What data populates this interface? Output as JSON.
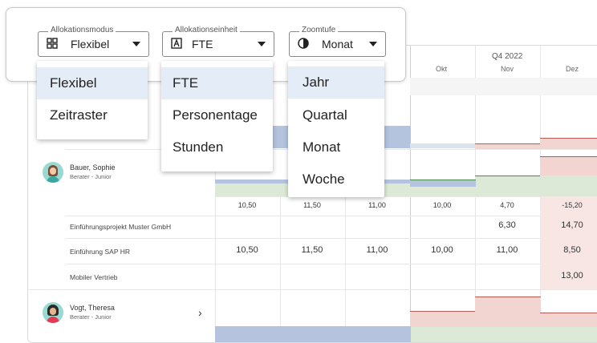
{
  "toolbar": {
    "allocation_mode": {
      "label": "Allokationsmodus",
      "value": "Flexibel",
      "icon": "grid-icon",
      "options": [
        "Flexibel",
        "Zeitraster"
      ]
    },
    "allocation_unit": {
      "label": "Allokationseinheit",
      "value": "FTE",
      "icon": "letter-a-icon",
      "options": [
        "FTE",
        "Personentage",
        "Stunden"
      ]
    },
    "zoom": {
      "label": "Zoomtufe",
      "value": "Monat",
      "icon": "half-circle-icon",
      "options": [
        "Jahr",
        "Quartal",
        "Monat",
        "Woche"
      ]
    }
  },
  "timeline": {
    "quarter": "Q4 2022",
    "months": [
      "Okt",
      "Nov",
      "Dez"
    ]
  },
  "people": [
    {
      "name": "Bauer, Sophie",
      "role": "Berater - Junior",
      "totals": [
        "10,50",
        "11,50",
        "11,00",
        "10,00",
        "4,70",
        "-15,20"
      ],
      "projects": [
        {
          "name": "Einführungsprojekt Muster GmbH",
          "values": [
            "",
            "",
            "",
            "",
            "6,30",
            "14,70"
          ]
        },
        {
          "name": "Einführung SAP HR",
          "values": [
            "10,50",
            "11,50",
            "11,00",
            "10,00",
            "11,00",
            "8,50"
          ]
        },
        {
          "name": "Mobiler Vertrieb",
          "values": [
            "",
            "",
            "",
            "",
            "",
            "13,00"
          ]
        }
      ]
    },
    {
      "name": "Vogt, Theresa",
      "role": "Berater - Junior"
    }
  ],
  "colors": {
    "accent_blue": "#e4edf7",
    "capacity_green": "#dbe9d6",
    "over_red": "#f2d4d0",
    "bar_blue": "#b4c4de"
  }
}
